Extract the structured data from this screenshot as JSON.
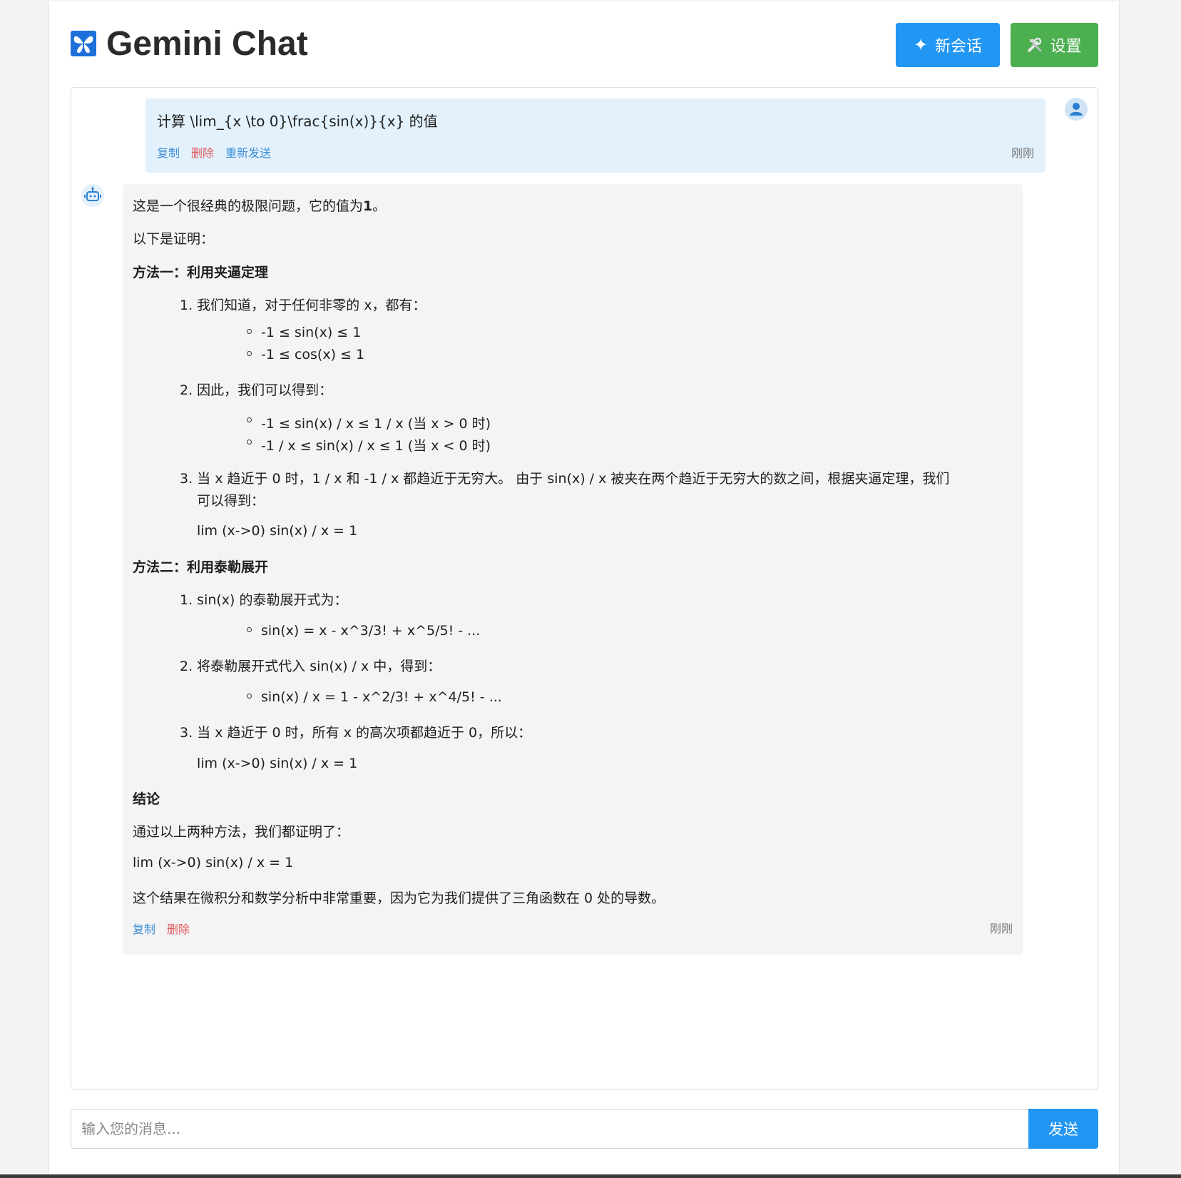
{
  "header": {
    "title": "Gemini Chat",
    "new_chat_label": "新会话",
    "settings_label": "设置",
    "logo_icon": "butterfly-logo-icon",
    "colors": {
      "new_chat": "#2196f3",
      "settings": "#4caf50"
    }
  },
  "user_message": {
    "text": "计算 \\lim_{x \\to 0}\\frac{sin(x)}{x} 的值",
    "actions": {
      "copy": "复制",
      "delete": "删除",
      "resend": "重新发送"
    },
    "timestamp": "刚刚"
  },
  "bot_message": {
    "intro": "这是一个很经典的极限问题，它的值为",
    "intro_value": "1",
    "intro_end": "。",
    "proof_label": "以下是证明：",
    "method1": {
      "heading": "方法一：利用夹逼定理",
      "step1": "我们知道，对于任何非零的 x，都有：",
      "step1_bullets": [
        "-1 ≤ sin(x) ≤ 1",
        "-1 ≤ cos(x) ≤ 1"
      ],
      "step2": "因此，我们可以得到：",
      "step2_bullets": [
        "-1 ≤ sin(x) / x ≤ 1 / x (当 x > 0 时)",
        "-1 / x ≤ sin(x) / x ≤ 1 (当 x < 0 时)"
      ],
      "step3_line1": "当 x 趋近于 0 时，1 / x 和 -1 / x 都趋近于无穷大。 由于 sin(x) / x 被夹在两个趋近于无穷大的数之间，根据夹逼定理，我们",
      "step3_line2": "可以得到：",
      "result": "lim (x->0) sin(x) / x = 1"
    },
    "method2": {
      "heading": "方法二：利用泰勒展开",
      "step1": "sin(x) 的泰勒展开式为：",
      "step1_bullets": [
        "sin(x) = x - x^3/3! + x^5/5! - ..."
      ],
      "step2": "将泰勒展开式代入 sin(x) / x 中，得到：",
      "step2_bullets": [
        "sin(x) / x = 1 - x^2/3! + x^4/5! - ..."
      ],
      "step3": "当 x 趋近于 0 时，所有 x 的高次项都趋近于 0，所以：",
      "result": "lim (x->0) sin(x) / x = 1"
    },
    "conclusion": {
      "heading": "结论",
      "text": "通过以上两种方法，我们都证明了：",
      "result": "lim (x->0) sin(x) / x = 1",
      "closing": "这个结果在微积分和数学分析中非常重要，因为它为我们提供了三角函数在 0 处的导数。"
    },
    "actions": {
      "copy": "复制",
      "delete": "删除"
    },
    "timestamp": "刚刚"
  },
  "input": {
    "placeholder": "输入您的消息...",
    "value": "",
    "send_label": "发送"
  }
}
